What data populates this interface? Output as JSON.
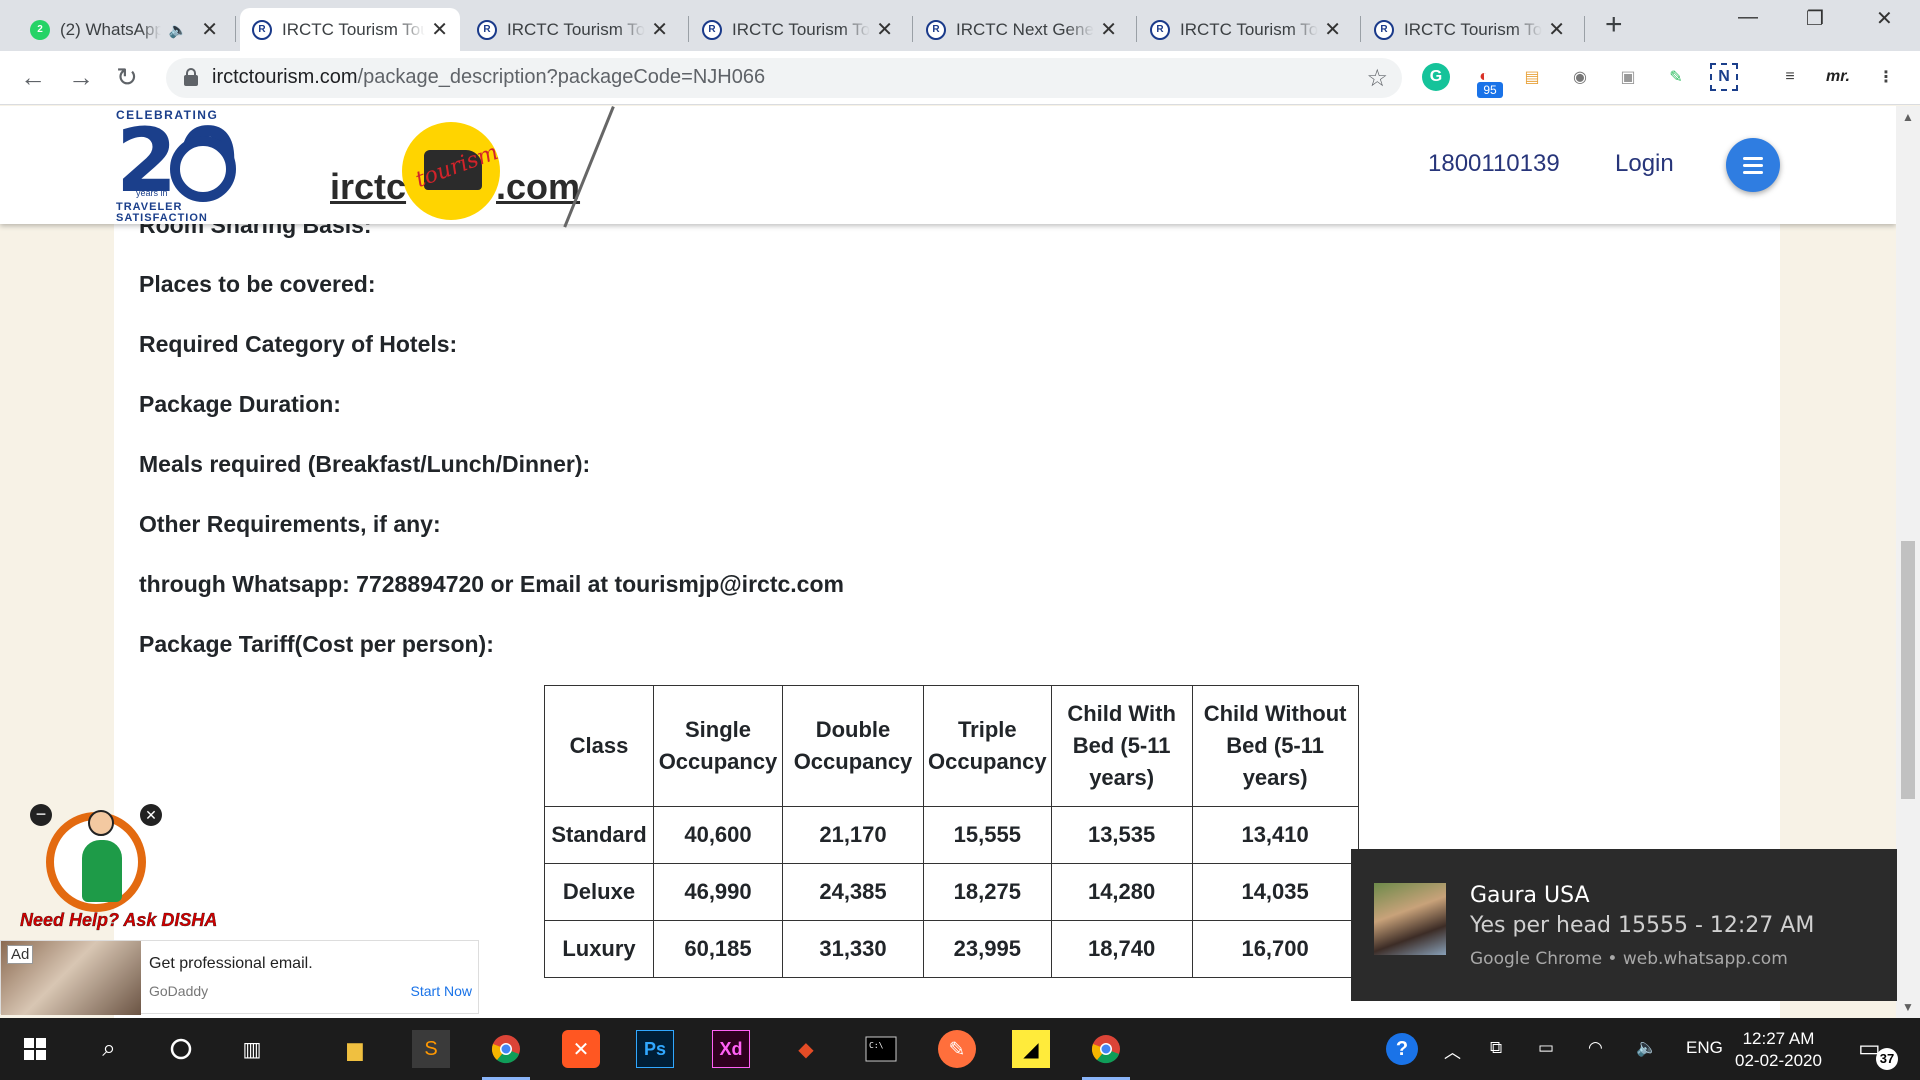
{
  "tabs": [
    {
      "title": "(2) WhatsApp",
      "favicon": "whatsapp-icon",
      "badge": "2",
      "active": false
    },
    {
      "title": "IRCTC Tourism Tourism",
      "favicon": "irctc-icon",
      "active": true
    },
    {
      "title": "IRCTC Tourism Tourism",
      "favicon": "irctc-icon",
      "active": false
    },
    {
      "title": "IRCTC Tourism Tourism",
      "favicon": "irctc-icon",
      "active": false
    },
    {
      "title": "IRCTC Next Generation",
      "favicon": "irctc-icon",
      "active": false
    },
    {
      "title": "IRCTC Tourism Tourism",
      "favicon": "irctc-icon",
      "active": false
    },
    {
      "title": "IRCTC Tourism Tourism",
      "favicon": "irctc-icon",
      "active": false
    }
  ],
  "address_bar": {
    "host": "irctctourism.com",
    "path": "/package_description?packageCode=NJH066"
  },
  "extensions": {
    "badge_count": "95"
  },
  "header": {
    "logo_celebrating": "CELEBRATING",
    "logo_number": "20",
    "logo_years": "years in",
    "logo_traveler": "TRAVELER",
    "logo_satisfaction": "SATISFACTION",
    "brand_left": "irctc",
    "brand_script": "tourism",
    "brand_right": ".com",
    "phone": "1800110139",
    "login": "Login"
  },
  "content": {
    "cut_line": "Room Sharing Basis:",
    "lines": [
      "Places to be covered:",
      "Required Category of Hotels:",
      "Package Duration:",
      "Meals required (Breakfast/Lunch/Dinner):",
      "Other Requirements, if any:",
      "through Whatsapp: 7728894720 or Email at tourismjp@irctc.com",
      "Package Tariff(Cost per person):"
    ]
  },
  "tariff": {
    "headers": [
      "Class",
      "Single Occupancy",
      "Double Occupancy",
      "Triple Occupancy",
      "Child With Bed (5-11 years)",
      "Child Without Bed (5-11 years)"
    ],
    "rows": [
      [
        "Standard",
        "40,600",
        "21,170",
        "15,555",
        "13,535",
        "13,410"
      ],
      [
        "Deluxe",
        "46,990",
        "24,385",
        "18,275",
        "14,280",
        "14,035"
      ],
      [
        "Luxury",
        "60,185",
        "31,330",
        "23,995",
        "18,740",
        "16,700"
      ]
    ]
  },
  "disha": {
    "help_text": "Need Help? Ask DISHA"
  },
  "ad": {
    "tag": "Ad",
    "headline": "Get professional email.",
    "brand": "GoDaddy",
    "cta": "Start Now"
  },
  "toast": {
    "sender": "Gaura USA",
    "message": "Yes per head 15555 - 12:27 AM",
    "source": "Google Chrome • web.whatsapp.com"
  },
  "taskbar": {
    "language": "ENG",
    "time": "12:27 AM",
    "date": "02-02-2020",
    "notification_count": "37"
  }
}
